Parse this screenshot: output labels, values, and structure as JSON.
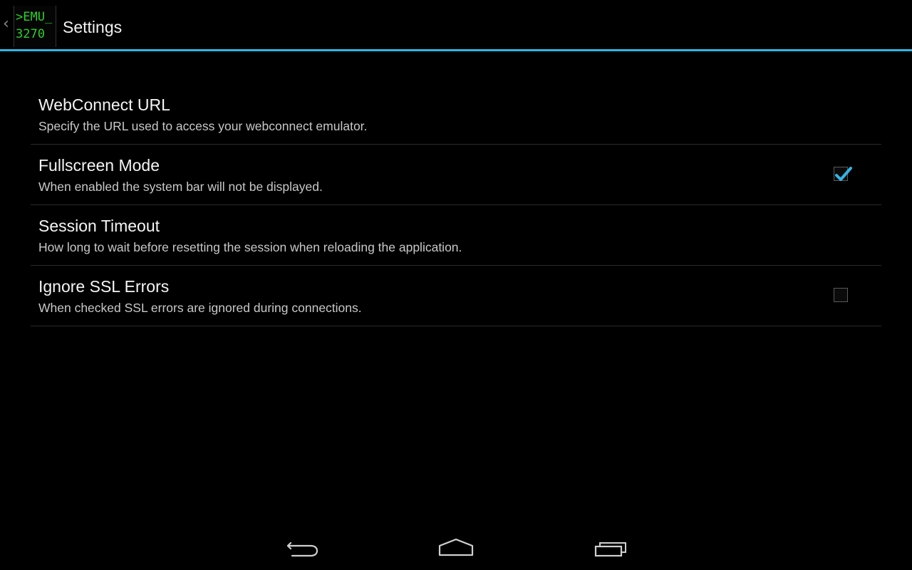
{
  "action_bar": {
    "title": "Settings",
    "icon_line1": ">EMU_",
    "icon_line2": "3270",
    "accent_color": "#33b5e5"
  },
  "preferences": [
    {
      "title": "WebConnect URL",
      "summary": "Specify the URL used to access your webconnect emulator."
    },
    {
      "title": "Fullscreen Mode",
      "summary": "When enabled the system bar will not be displayed.",
      "checked": true
    },
    {
      "title": "Session Timeout",
      "summary": "How long to wait before resetting the session when reloading the application."
    },
    {
      "title": "Ignore SSL Errors",
      "summary": "When checked SSL errors are ignored during connections.",
      "checked": false
    }
  ],
  "nav_bar": {
    "icons": [
      "back-icon",
      "home-icon",
      "recent-apps-icon"
    ]
  }
}
